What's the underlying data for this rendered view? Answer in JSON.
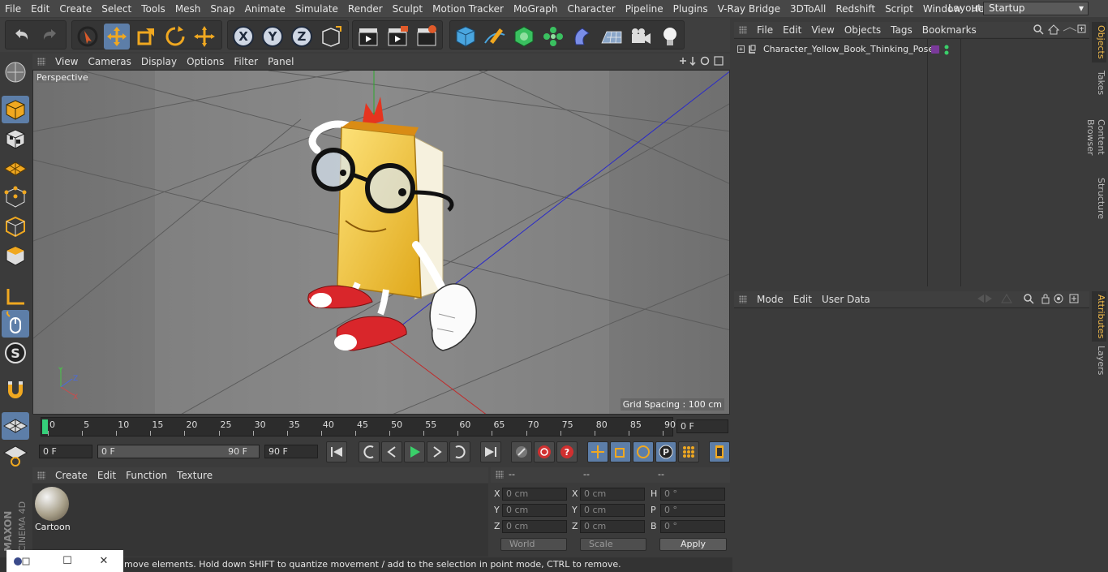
{
  "menubar": {
    "items": [
      "File",
      "Edit",
      "Create",
      "Select",
      "Tools",
      "Mesh",
      "Snap",
      "Animate",
      "Simulate",
      "Render",
      "Sculpt",
      "Motion Tracker",
      "MoGraph",
      "Character",
      "Pipeline",
      "Plugins",
      "V-Ray Bridge",
      "3DToAll",
      "Redshift",
      "Script",
      "Window",
      "Help"
    ],
    "layout_label": "Layout:",
    "layout_value": "Startup"
  },
  "viewport": {
    "menu": [
      "View",
      "Cameras",
      "Display",
      "Options",
      "Filter",
      "Panel"
    ],
    "label": "Perspective",
    "grid_spacing": "Grid Spacing : 100 cm"
  },
  "timeline": {
    "ticks": [
      "0",
      "5",
      "10",
      "15",
      "20",
      "25",
      "30",
      "35",
      "40",
      "45",
      "50",
      "55",
      "60",
      "65",
      "70",
      "75",
      "80",
      "85",
      "90"
    ],
    "current_frame": "0 F",
    "start_frame": "0 F",
    "range_start": "0 F",
    "range_end": "90 F",
    "end_frame": "90 F"
  },
  "material_manager": {
    "menu": [
      "Create",
      "Edit",
      "Function",
      "Texture"
    ],
    "material_name": "Cartoon"
  },
  "coordinates": {
    "header": [
      "--",
      "--",
      "--"
    ],
    "pos_labels": [
      "X",
      "Y",
      "Z"
    ],
    "size_labels": [
      "X",
      "Y",
      "Z"
    ],
    "rot_labels": [
      "H",
      "P",
      "B"
    ],
    "pos_values": [
      "0 cm",
      "0 cm",
      "0 cm"
    ],
    "size_values": [
      "0 cm",
      "0 cm",
      "0 cm"
    ],
    "rot_values": [
      "0 °",
      "0 °",
      "0 °"
    ],
    "space": "World",
    "mode": "Scale",
    "apply": "Apply"
  },
  "object_manager": {
    "menu": [
      "File",
      "Edit",
      "View",
      "Objects",
      "Tags",
      "Bookmarks"
    ],
    "object_name": "Character_Yellow_Book_Thinking_Pose"
  },
  "attribute_manager": {
    "menu": [
      "Mode",
      "Edit",
      "User Data"
    ]
  },
  "right_tabs": [
    "Objects",
    "Takes",
    "Content Browser",
    "Structure",
    "Attributes",
    "Layers"
  ],
  "status_text": "move elements. Hold down SHIFT to quantize movement / add to the selection in point mode, CTRL to remove.",
  "branding": "MAXON CINEMA 4D",
  "colors": {
    "accent": "#5d7ea8",
    "active_tab": "#f0b94a",
    "book_yellow": "#f2c72a",
    "shoe_red": "#d9262b"
  }
}
